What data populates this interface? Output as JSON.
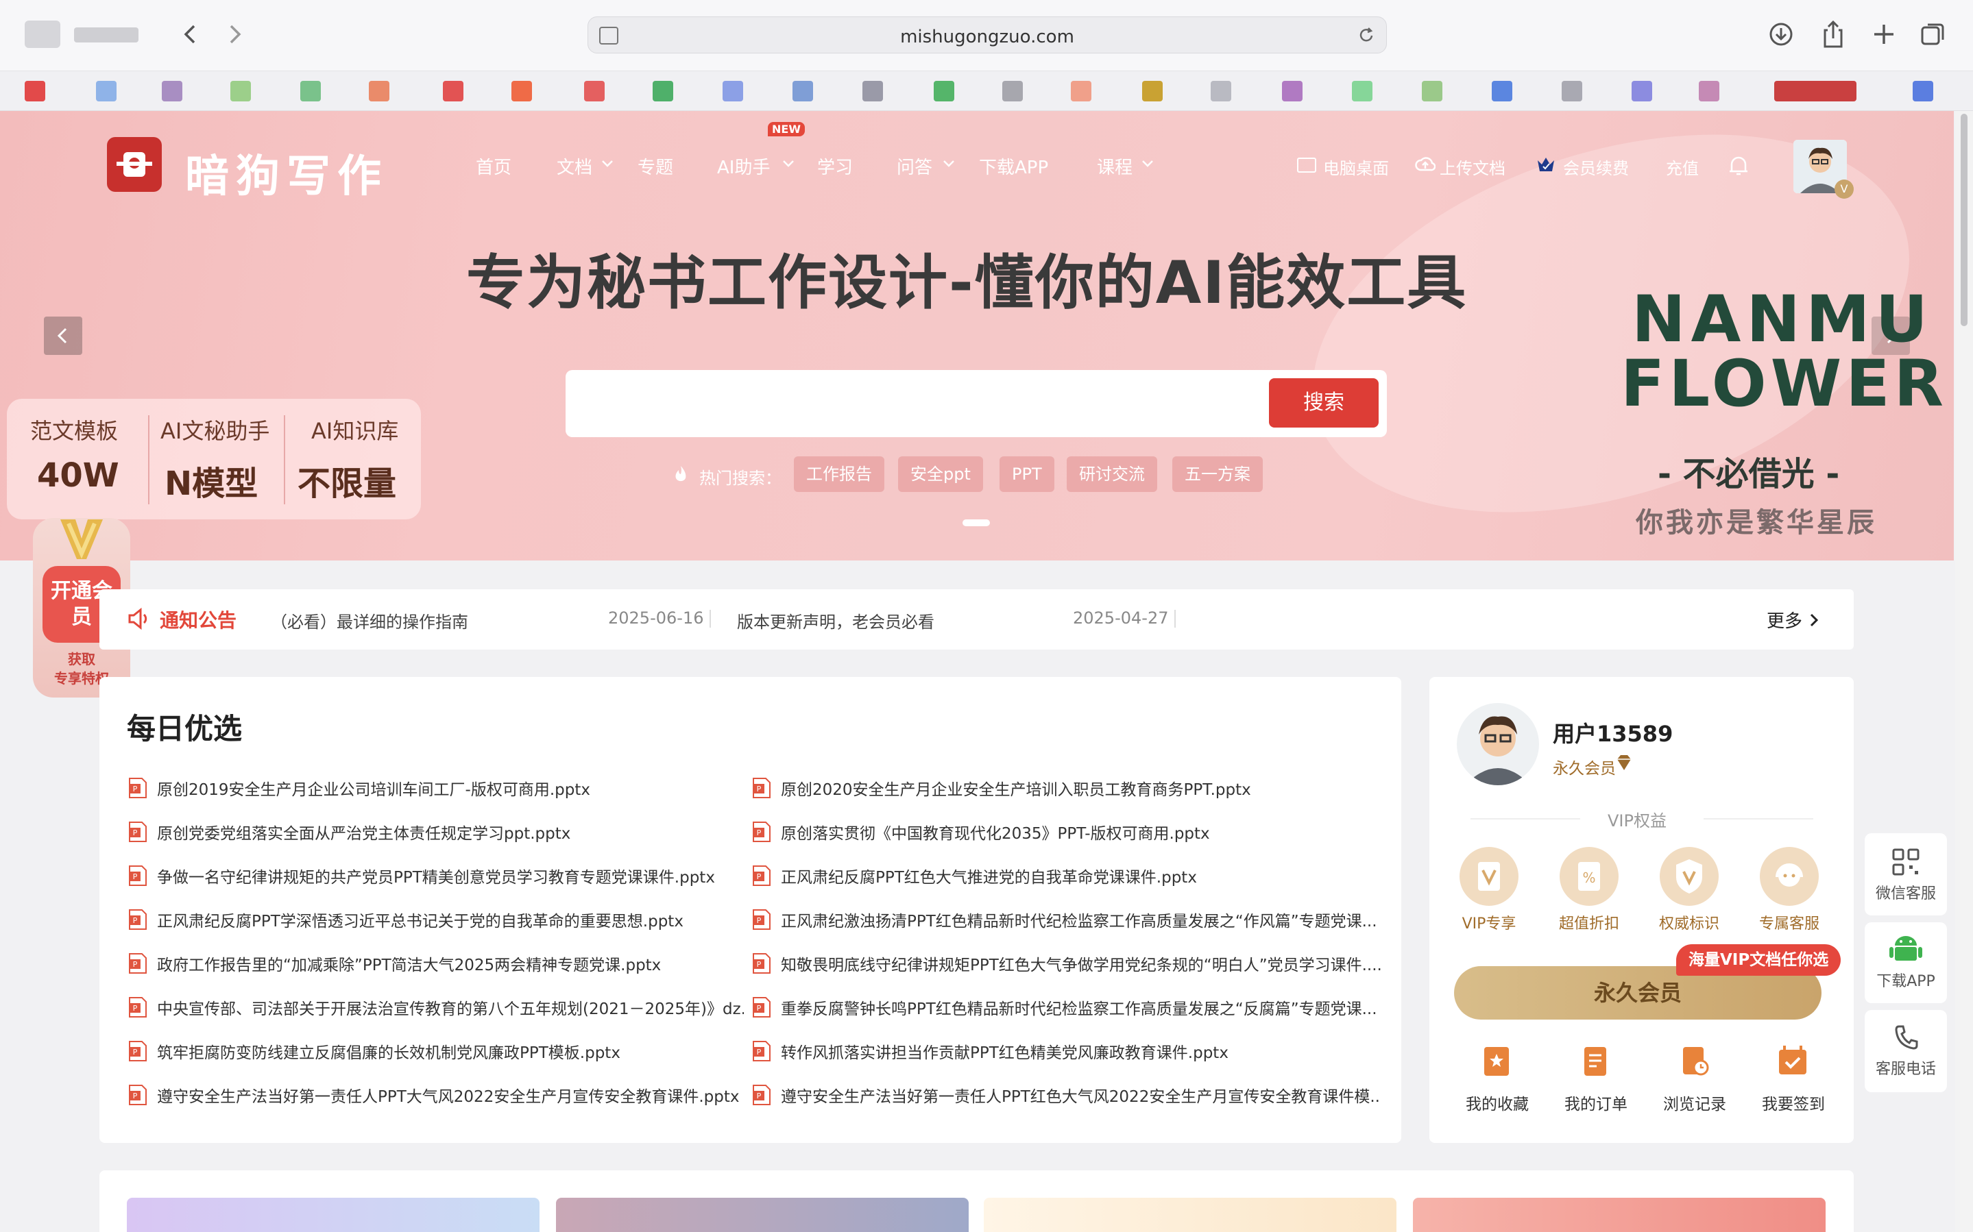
{
  "browser": {
    "url": "mishugongzuo.com"
  },
  "site": {
    "logo_text": "暗狗写作",
    "nav": [
      "首页",
      "文档",
      "专题",
      "AI助手",
      "学习",
      "问答",
      "下载APP",
      "课程"
    ],
    "new_badge": "NEW",
    "right_nav": [
      "电脑桌面",
      "上传文档",
      "会员续费",
      "充值"
    ]
  },
  "hero": {
    "headline": "专为秘书工作设计-懂你的AI能效工具",
    "search_button": "搜索",
    "search_placeholder": "",
    "hot_label": "热门搜索：",
    "hot_tags": [
      "工作报告",
      "安全ppt",
      "PPT",
      "研讨交流",
      "五一方案"
    ],
    "stats": [
      {
        "label": "范文模板",
        "value": "40W"
      },
      {
        "label": "AI文秘助手",
        "value": "N模型"
      },
      {
        "label": "AI知识库",
        "value": "不限量"
      }
    ],
    "side_ad": {
      "line1": "NANMU",
      "line2": "FLOWER",
      "line3": "- 不必借光 -",
      "line4": "你我亦是繁华星辰"
    }
  },
  "vip_float": {
    "open": "开通会员",
    "get": "获取",
    "privilege": "专享特权"
  },
  "notice": {
    "title": "通知公告",
    "items": [
      {
        "text": "（必看）最详细的操作指南",
        "date": "2025-06-16"
      },
      {
        "text": "版本更新声明，老会员必看",
        "date": "2025-04-27"
      }
    ],
    "more": "更多"
  },
  "daily": {
    "title": "每日优选",
    "left": [
      "原创2019安全生产月企业公司培训车间工厂-版权可商用.pptx",
      "原创党委党组落实全面从严治党主体责任规定学习ppt.pptx",
      "争做一名守纪律讲规矩的共产党员PPT精美创意党员学习教育专题党课课件.pptx",
      "正风肃纪反腐PPT学深悟透习近平总书记关于党的自我革命的重要思想.pptx",
      "政府工作报告里的“加减乘除”PPT简洁大气2025两会精神专题党课.pptx",
      "中央宣传部、司法部关于开展法治宣传教育的第八个五年规划(2021－2025年)》dz...",
      "筑牢拒腐防变防线建立反腐倡廉的长效机制党风廉政PPT模板.pptx",
      "遵守安全生产法当好第一责任人PPT大气风2022安全生产月宣传安全教育课件.pptx"
    ],
    "right": [
      "原创2020安全生产月企业安全生产培训入职员工教育商务PPT.pptx",
      "原创落实贯彻《中国教育现代化2035》PPT-版权可商用.pptx",
      "正风肃纪反腐PPT红色大气推进党的自我革命党课课件.pptx",
      "正风肃纪激浊扬清PPT红色精品新时代纪检监察工作高质量发展之“作风篇”专题党课...",
      "知敬畏明底线守纪律讲规矩PPT红色大气争做学用党纪条规的“明白人”党员学习课件....",
      "重拳反腐警钟长鸣PPT红色精品新时代纪检监察工作高质量发展之“反腐篇”专题党课...",
      "转作风抓落实讲担当作贡献PPT红色精美党风廉政教育课件.pptx",
      "遵守安全生产法当好第一责任人PPT红色大气风2022安全生产月宣传安全教育课件模..."
    ]
  },
  "user": {
    "name": "用户13589",
    "level": "永久会员",
    "vip_rights_title": "VIP权益",
    "rights": [
      "VIP专享",
      "超值折扣",
      "权威标识",
      "专属客服"
    ],
    "promo_badge": "海量VIP文档任你选",
    "member_button": "永久会员",
    "actions": [
      "我的收藏",
      "我的订单",
      "浏览记录",
      "我要签到"
    ]
  },
  "float_right": [
    "微信客服",
    "下载APP",
    "客服电话"
  ],
  "colors": {
    "brand_red": "#dd3d36",
    "gold": "#c9a46b",
    "banner_pink": "#f5c6c6"
  }
}
